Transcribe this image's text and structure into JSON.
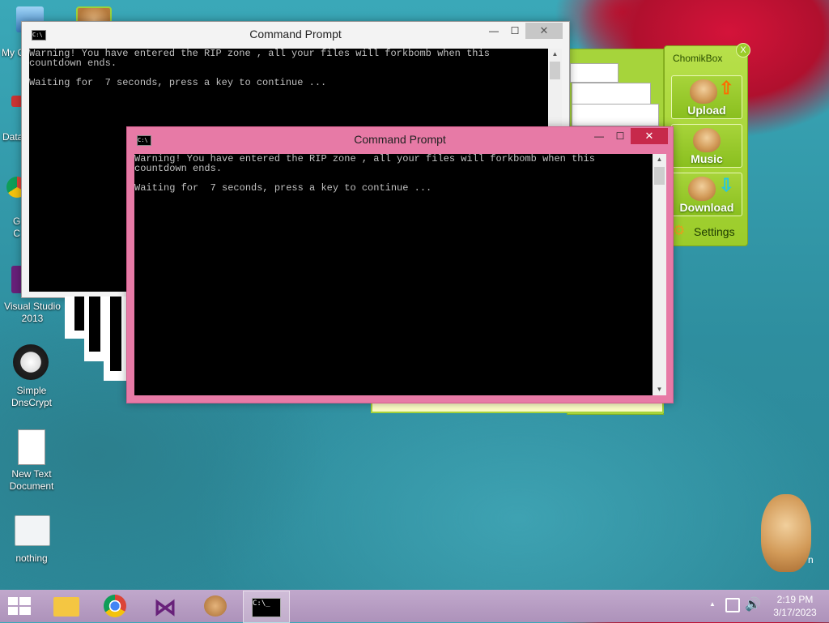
{
  "desktop": {
    "icons": [
      {
        "label": "My C"
      },
      {
        "label": "Data"
      },
      {
        "label": "G\nC"
      },
      {
        "label": "Visual Studio\n2013"
      },
      {
        "label": "Simple\nDnsCrypt"
      },
      {
        "label": "New Text\nDocument"
      },
      {
        "label": "nothing"
      }
    ],
    "stray_text": "n"
  },
  "back_window": {
    "title": "Command Prompt",
    "icon_text": "C:\\",
    "lines": "Warning! You have entered the RIP zone , all your files will forkbomb when this\ncountdown ends.\n\nWaiting for  7 seconds, press a key to continue ..."
  },
  "front_window": {
    "title": "Command Prompt",
    "icon_text": "C:\\",
    "lines": "Warning! You have entered the RIP zone , all your files will forkbomb when this\ncountdown ends.\n\nWaiting for  7 seconds, press a key to continue ..."
  },
  "window_controls": {
    "minimize": "—",
    "maximize": "☐",
    "close": "✕"
  },
  "chomikbox": {
    "title": "ChomikBox",
    "close": "X",
    "buttons": [
      {
        "label": "Upload"
      },
      {
        "label": "Music"
      },
      {
        "label": "Download"
      }
    ],
    "settings_label": "Settings"
  },
  "taskbar": {
    "apps": [
      "file-explorer",
      "chrome",
      "visual-studio",
      "chomikbox",
      "command-prompt"
    ],
    "cmd_icon_text": "C:\\_",
    "tray_chevron": "▲",
    "time": "2:19 PM",
    "date": "3/17/2023"
  }
}
